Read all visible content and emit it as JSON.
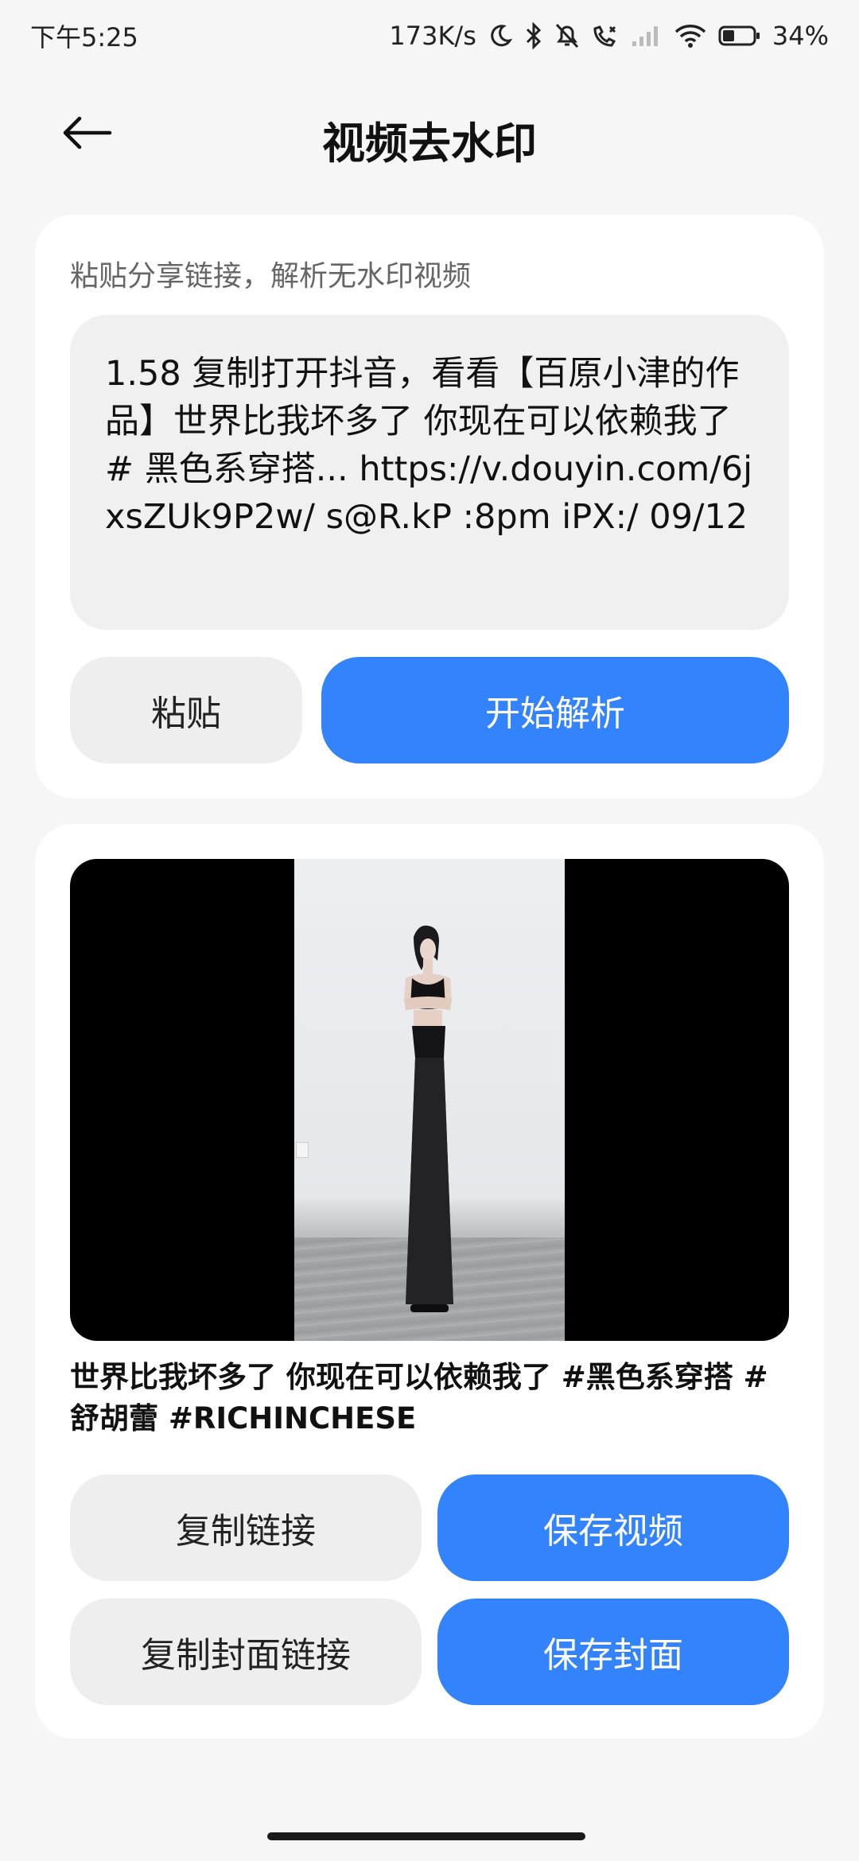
{
  "status_bar": {
    "time": "下午5:25",
    "network_speed": "173K/s",
    "battery": "34%",
    "icons": [
      "moon-icon",
      "bluetooth-icon",
      "bell-off-icon",
      "call-forward-icon",
      "signal-icon",
      "wifi-icon",
      "battery-icon"
    ]
  },
  "header": {
    "title": "视频去水印",
    "back_icon": "back-arrow-icon"
  },
  "input_card": {
    "label": "粘贴分享链接，解析无水印视频",
    "link_text": "1.58 复制打开抖音，看看【百原小津的作品】世界比我坏多了 你现在可以依赖我了 # 黑色系穿搭... https://v.douyin.com/6jxsZUk9P2w/ s@R.kP :8pm iPX:/ 09/12",
    "paste_label": "粘贴",
    "parse_label": "开始解析"
  },
  "result_card": {
    "caption": "世界比我坏多了 你现在可以依赖我了 #黑色系穿搭 #舒胡蕾 #RICHINCHESE",
    "copy_link_label": "复制链接",
    "save_video_label": "保存视频",
    "copy_cover_label": "复制封面链接",
    "save_cover_label": "保存封面"
  },
  "colors": {
    "accent": "#3383fc",
    "background": "#f6f6f6",
    "card": "#ffffff",
    "gray_button": "#eeeeee"
  }
}
